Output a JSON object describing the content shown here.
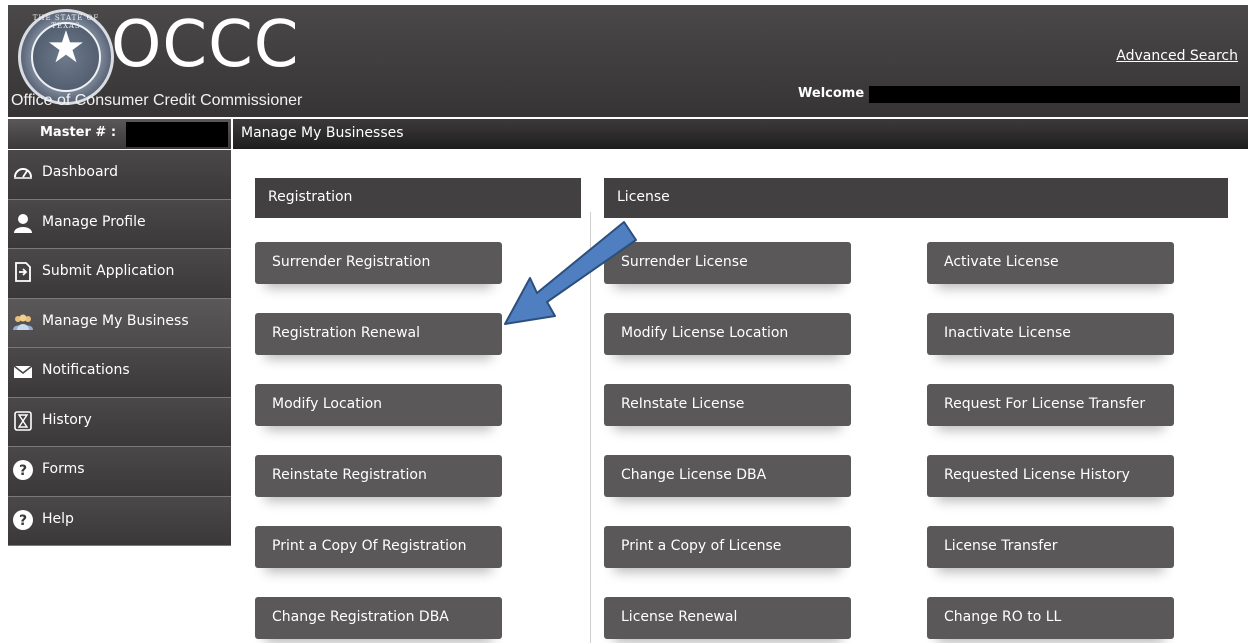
{
  "header": {
    "brand": "OCCC",
    "tagline": "Office of Consumer Credit Commissioner",
    "seal_text": "THE STATE OF TEXAS",
    "advanced_search": "Advanced Search",
    "welcome": "Welcome"
  },
  "master": {
    "label": "Master # :"
  },
  "sidebar": {
    "items": [
      {
        "label": "Dashboard",
        "icon": "speedometer-icon"
      },
      {
        "label": "Manage Profile",
        "icon": "user-icon"
      },
      {
        "label": "Submit Application",
        "icon": "submit-icon"
      },
      {
        "label": "Manage My Business",
        "icon": "group-icon",
        "active": true
      },
      {
        "label": "Notifications",
        "icon": "envelope-icon"
      },
      {
        "label": "History",
        "icon": "hourglass-icon"
      },
      {
        "label": "Forms",
        "icon": "question-icon"
      },
      {
        "label": "Help",
        "icon": "question-icon"
      }
    ]
  },
  "main": {
    "title": "Manage My Businesses",
    "registration": {
      "header": "Registration",
      "buttons": [
        "Surrender Registration",
        "Registration Renewal",
        "Modify Location",
        "Reinstate Registration",
        "Print a Copy Of Registration",
        "Change Registration DBA"
      ]
    },
    "license": {
      "header": "License",
      "col1": [
        "Surrender License",
        "Modify License Location",
        "ReInstate License",
        "Change License DBA",
        "Print a Copy of License",
        "License Renewal"
      ],
      "col2": [
        "Activate License",
        "Inactivate License",
        "Request For License Transfer",
        "Requested License History",
        "License Transfer",
        "Change RO to LL"
      ]
    }
  },
  "colors": {
    "header_bg": "#3e3c3c",
    "button_bg": "#5a5858",
    "arrow_fill": "#4f7fc0",
    "arrow_stroke": "#2c4f7c"
  }
}
